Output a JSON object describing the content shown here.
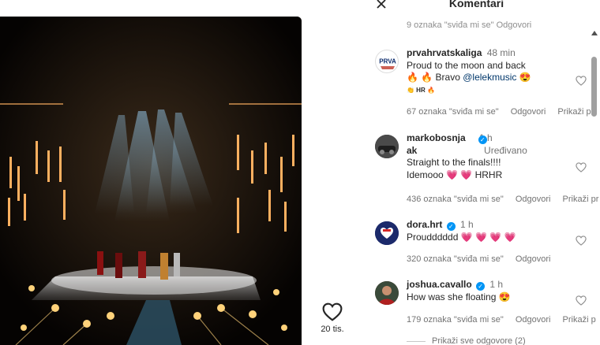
{
  "panel": {
    "title": "Komentari",
    "previous_meta": "9 oznaka \"sviđa mi se\"   Odgovori"
  },
  "post": {
    "like_count": "20 tis."
  },
  "comments": [
    {
      "username": "prvahrvatskaliga",
      "time": "48 min",
      "avatar_text": "PRVA",
      "text_line1": "Proud to the moon and back",
      "text_line2_pre": "🔥 🔥 Bravo ",
      "mention": "@lelekmusic",
      "text_line2_post": " 😍",
      "text_line3": "👏 HR 🔥",
      "likes": "67 oznaka \"sviđa mi se\"",
      "reply": "Odgovori",
      "translate": "Prikaži pri"
    },
    {
      "username_line1": "markobosnja",
      "username_line2": "ak",
      "time": "1 h",
      "edited": "Uređivano",
      "text_line1": "Straight to the finals!!!!",
      "text_line2": "Idemooo 💗 💗 HRHR",
      "likes": "436 oznaka \"sviđa mi se\"",
      "reply": "Odgovori",
      "translate": "Prikaži pr"
    },
    {
      "username": "dora.hrt",
      "time": "1 h",
      "text_line1": "Proudddddd 💗 💗 💗 💗",
      "likes": "320 oznaka \"sviđa mi se\"",
      "reply": "Odgovori"
    },
    {
      "username": "joshua.cavallo",
      "time": "1 h",
      "text_line1": "How was she floating 😍",
      "likes": "179 oznaka \"sviđa mi se\"",
      "reply": "Odgovori",
      "translate": "Prikaži p"
    }
  ],
  "view_replies": "Prikaži sve odgovore (2)",
  "colors": {
    "verified": "#0095f6",
    "mention": "#00376b",
    "muted": "#737373"
  },
  "icons": [
    "close-icon",
    "heart-icon",
    "verified-icon",
    "scroll-up-icon"
  ]
}
